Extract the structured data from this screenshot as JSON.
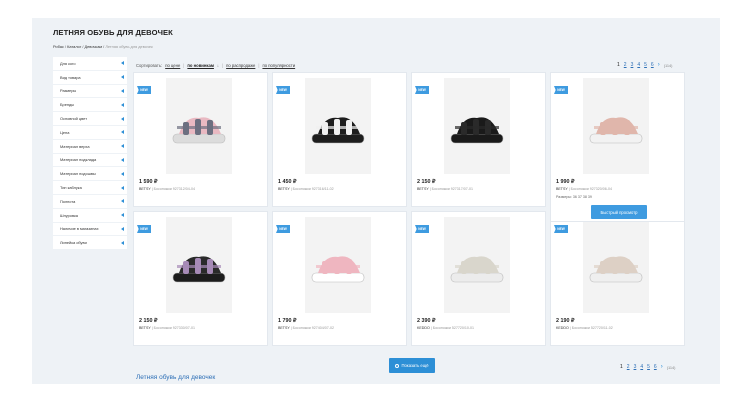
{
  "page": {
    "title": "ЛЕТНЯЯ ОБУВЬ ДЛЯ ДЕВОЧЕК",
    "bottom_title": "Летняя обувь для девочек"
  },
  "breadcrumb": [
    {
      "label": "Робас"
    },
    {
      "label": "Каталог"
    },
    {
      "label": "Девочкам"
    },
    {
      "label": "Летняя обувь для девочек"
    }
  ],
  "sidebar": {
    "items": [
      {
        "label": "Для кого"
      },
      {
        "label": "Вид товара"
      },
      {
        "label": "Размеры"
      },
      {
        "label": "Бренды"
      },
      {
        "label": "Основной цвет"
      },
      {
        "label": "Цена"
      },
      {
        "label": "Материал верха"
      },
      {
        "label": "Материал подклада"
      },
      {
        "label": "Материал подошвы"
      },
      {
        "label": "Тип каблука"
      },
      {
        "label": "Полнота"
      },
      {
        "label": "Шнуровка"
      },
      {
        "label": "Наличие в магазинах"
      },
      {
        "label": "Линейка обуви"
      }
    ]
  },
  "sort": {
    "label": "Сортировать:",
    "options": [
      "по цене",
      "по новинкам",
      "по распродаже",
      "по популярности"
    ],
    "active_arrow": "↓"
  },
  "pager": {
    "pages": [
      "1",
      "2",
      "3",
      "4",
      "5",
      "6"
    ],
    "next": "›",
    "total": "(114)"
  },
  "products": [
    {
      "badge": "NEW",
      "price": "1 590 ₽",
      "brand": "BETSY",
      "article": " | Босоножки 927312/04-04",
      "color": "#e9b9c2",
      "sole": "#dcdcdc",
      "strap": "#6c6f80"
    },
    {
      "badge": "NEW",
      "price": "1 450 ₽",
      "brand": "BETSY",
      "article": " | Босоножки 927316/11-02",
      "color": "#1d1d1d",
      "sole": "#1d1d1d",
      "strap": "#f0f0f0"
    },
    {
      "badge": "NEW",
      "price": "2 150 ₽",
      "brand": "BETSY",
      "article": " | Босоножки 927317/07-01",
      "color": "#1a1a1a",
      "sole": "#1a1a1a",
      "strap": "#2a2a2a"
    },
    {
      "badge": "NEW",
      "price": "1 990 ₽",
      "brand": "BETSY",
      "article": " | Босоножки 927320/06-04",
      "color": "#e0b6ab",
      "sole": "#f2f2f2",
      "strap": "#e0b6ab",
      "sizes": "Размеры: 36 37 38 39",
      "quick_view": "Быстрый просмотр"
    },
    {
      "badge": "NEW",
      "price": "2 150 ₽",
      "brand": "BETSY",
      "article": " | Босоножки 927330/07-01",
      "color": "#2a2a2a",
      "sole": "#1c1c1c",
      "strap": "#a68ab6"
    },
    {
      "badge": "NEW",
      "price": "1 790 ₽",
      "brand": "BETSY",
      "article": " | Босоножки 927404/07-02",
      "color": "#efb6c0",
      "sole": "#ffffff",
      "strap": "#efb6c0"
    },
    {
      "badge": "NEW",
      "price": "2 390 ₽",
      "brand": "KEDDO",
      "article": " | Босоножки 527720/10-01",
      "color": "#d9d6cc",
      "sole": "#ececec",
      "strap": "#d9d6cc"
    },
    {
      "badge": "NEW",
      "price": "2 190 ₽",
      "brand": "KEDDO",
      "article": " | Босоножки 527720/11-02",
      "color": "#ddd0c5",
      "sole": "#efefef",
      "strap": "#ddd0c5"
    }
  ],
  "show_more": "Показать ещё",
  "colors": {
    "accent": "#2d8fd6",
    "badge": "#3e9be0",
    "background": "#eef2f6"
  }
}
